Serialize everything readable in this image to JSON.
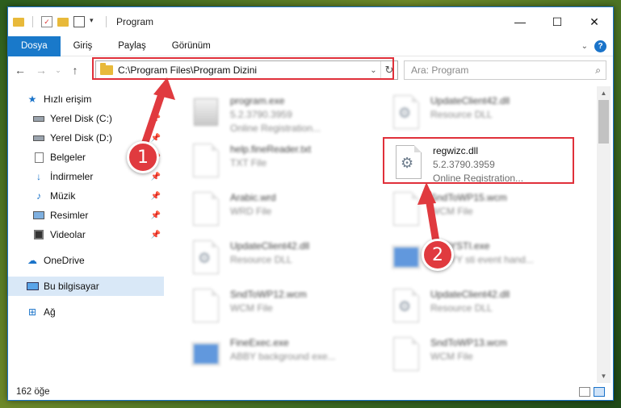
{
  "window": {
    "title": "Program",
    "controls": [
      "—",
      "☐",
      "✕"
    ]
  },
  "ribbon": {
    "tabs": [
      "Dosya",
      "Giriş",
      "Paylaş",
      "Görünüm"
    ],
    "active_tab": "Dosya"
  },
  "navigation": {
    "address_path": "C:\\Program Files\\Program Dizini",
    "search_placeholder": "Ara: Program"
  },
  "sidebar": {
    "items": [
      {
        "label": "Hızlı erişim",
        "icon": "star-icon",
        "pinned": false
      },
      {
        "label": "Yerel Disk (C:)",
        "icon": "drive-icon",
        "pinned": true
      },
      {
        "label": "Yerel Disk (D:)",
        "icon": "drive-icon",
        "pinned": true
      },
      {
        "label": "Belgeler",
        "icon": "documents-icon",
        "pinned": true
      },
      {
        "label": "İndirmeler",
        "icon": "download-icon",
        "pinned": true
      },
      {
        "label": "Müzik",
        "icon": "music-icon",
        "pinned": true
      },
      {
        "label": "Resimler",
        "icon": "pictures-icon",
        "pinned": true
      },
      {
        "label": "Videolar",
        "icon": "video-icon",
        "pinned": true
      },
      {
        "label": "OneDrive",
        "icon": "cloud-icon",
        "pinned": false
      },
      {
        "label": "Bu bilgisayar",
        "icon": "computer-icon",
        "pinned": false,
        "selected": true
      },
      {
        "label": "Ağ",
        "icon": "network-icon",
        "pinned": false
      }
    ]
  },
  "files": [
    {
      "name": "program.exe",
      "line2": "5.2.3790.3959",
      "line3": "Online Registration...",
      "kind": "exe"
    },
    {
      "name": "UpdateClient42.dll",
      "line2": "Resource DLL",
      "line3": "",
      "kind": "dll"
    },
    {
      "name": "help.fineReader.txt",
      "line2": "TXT File",
      "line3": "",
      "kind": "txt"
    },
    {
      "name": "regwizc.dll",
      "line2": "5.2.3790.3959",
      "line3": "Online Registration...",
      "kind": "dll"
    },
    {
      "name": "Arabic.wrd",
      "line2": "WRD File",
      "line3": "",
      "kind": "txt"
    },
    {
      "name": "SndToWP15.wcm",
      "line2": "WCM File",
      "line3": "",
      "kind": "txt"
    },
    {
      "name": "UpdateClient42.dll",
      "line2": "Resource DLL",
      "line3": "",
      "kind": "dll"
    },
    {
      "name": "ABBYSTI.exe",
      "line2": "ABBYY sti event hand...",
      "line3": "",
      "kind": "app"
    },
    {
      "name": "SndToWP12.wcm",
      "line2": "WCM File",
      "line3": "",
      "kind": "txt"
    },
    {
      "name": "UpdateClient42.dll",
      "line2": "Resource DLL",
      "line3": "",
      "kind": "dll"
    },
    {
      "name": "FineExec.exe",
      "line2": "ABBY background exe...",
      "line3": "",
      "kind": "app"
    },
    {
      "name": "SndToWP13.wcm",
      "line2": "WCM File",
      "line3": "",
      "kind": "txt"
    }
  ],
  "status": {
    "item_count": "162 öğe"
  },
  "annotations": {
    "marker_1": "1",
    "marker_2": "2",
    "color": "#e03a3f"
  },
  "colors": {
    "accent": "#1979ca",
    "highlight": "#e0303a"
  }
}
